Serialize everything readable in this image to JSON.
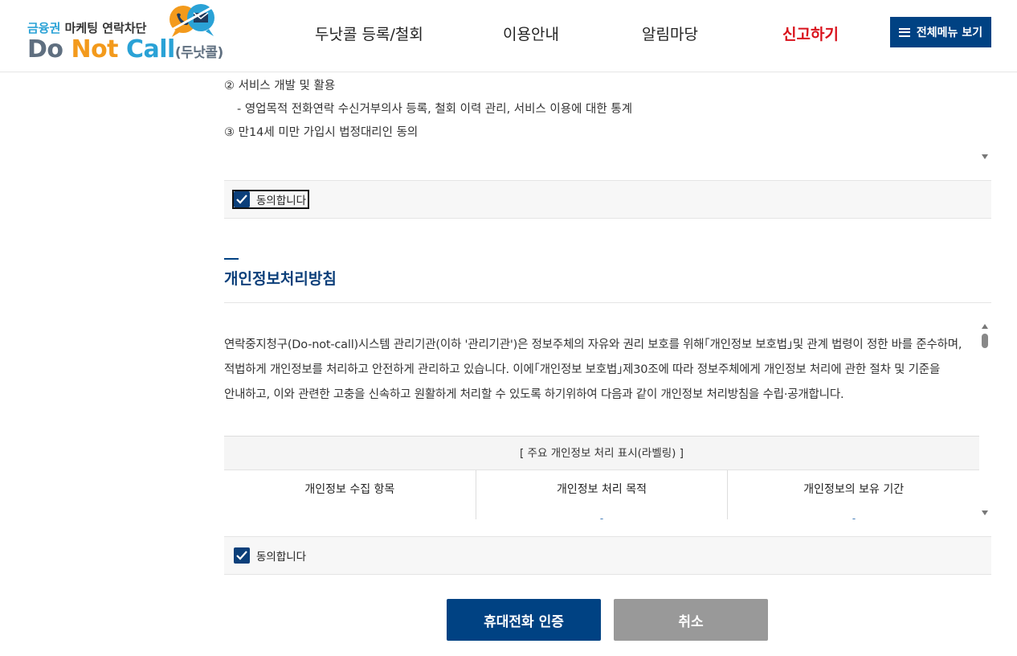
{
  "logo": {
    "sub_part1": "금융권",
    "sub_part2": " 마케팅 연락차단",
    "main_do": "Do ",
    "main_not": "Not ",
    "main_call": "Call",
    "main_kor": "(두낫콜)"
  },
  "nav": {
    "item1": "두낫콜 등록/철회",
    "item2": "이용안내",
    "item3": "알림마당",
    "item4": "신고하기",
    "menu_button": "전체메뉴 보기"
  },
  "terms1": {
    "line1": "② 서비스 개발 및 활용",
    "line2": "- 영업목적 전화연락 수신거부의사 등록, 철회 이력 관리, 서비스 이용에 대한 통계",
    "line3": "③ 만14세 미만 가입시 법정대리인 동의"
  },
  "agree1": {
    "label": "동의합니다",
    "checked": true
  },
  "privacy": {
    "title": "개인정보처리방침",
    "paragraph": "연락중지청구(Do-not-call)시스템 관리기관(이하 '관리기관')은   정보주체의 자유와 권리 보호를 위해｢개인정보 보호법｣및 관계 법령이 정한 바를 준수하며, 적법하게 개인정보를 처리하고 안전하게 관리하고 있습니다. 이에｢개인정보 보호법｣제30조에 따라 정보주체에게 개인정보 처리에 관한 절차 및 기준을 안내하고, 이와 관련한 고충을 신속하고 원활하게 처리할 수 있도록 하기위하여 다음과 같이 개인정보 처리방침을 수립·공개합니다.",
    "table_header": "[ 주요 개인정보 처리 표시(라벨링) ]",
    "columns": [
      "개인정보 수집 항목",
      "개인정보 처리 목적",
      "개인정보의 보유 기간"
    ]
  },
  "agree2": {
    "label": "동의합니다",
    "checked": true
  },
  "buttons": {
    "primary": "휴대전화 인증",
    "cancel": "취소"
  },
  "colors": {
    "primary": "#004283",
    "alert_nav": "#d9121c",
    "cancel": "#999999"
  }
}
